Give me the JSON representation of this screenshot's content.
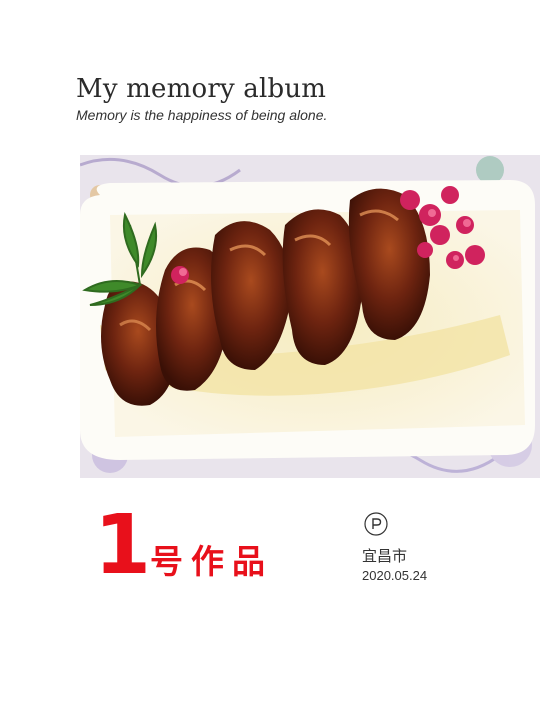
{
  "album": {
    "title": "My memory album",
    "subtitle": "Memory is the happiness of being alone."
  },
  "photo": {
    "subject": "glazed-chicken-wings-on-plate"
  },
  "caption": {
    "number": "1",
    "label": "号作品",
    "location_icon": "parking-p-icon",
    "city": "宜昌市",
    "date": "2020.05.24"
  },
  "colors": {
    "accent": "#e8101b",
    "text": "#2b2b2b"
  }
}
